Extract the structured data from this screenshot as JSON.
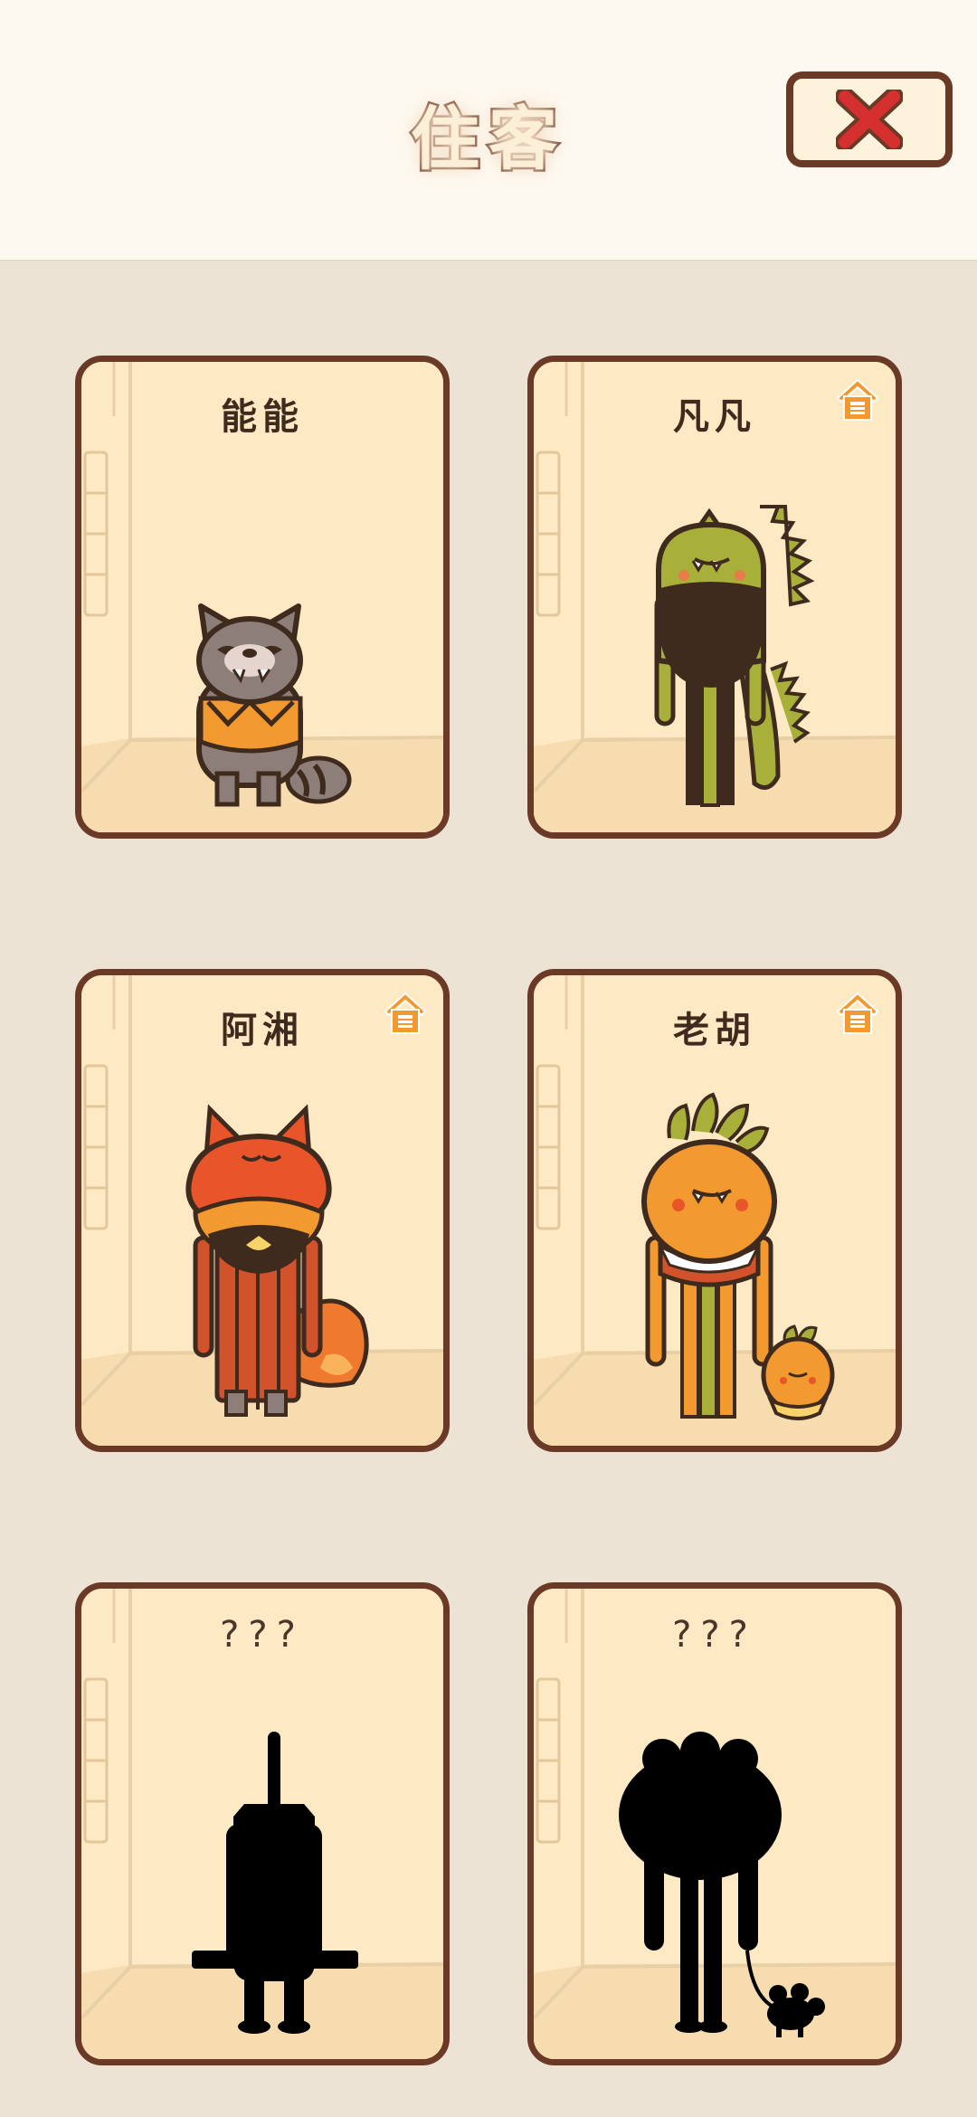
{
  "header": {
    "title": "住客",
    "close_icon": "close-x-icon"
  },
  "colors": {
    "page_bg": "#ede3d4",
    "header_bg": "#fdf9f0",
    "card_bg": "#fde9c4",
    "card_border": "#6a3a26",
    "close_x": "#d62f2f",
    "badge": "#f2992f"
  },
  "residents": [
    {
      "name": "能能",
      "has_house": false,
      "unlocked": true,
      "character": "raccoon"
    },
    {
      "name": "凡凡",
      "has_house": true,
      "unlocked": true,
      "character": "green-dinosaur"
    },
    {
      "name": "阿湘",
      "has_house": true,
      "unlocked": true,
      "character": "red-fox"
    },
    {
      "name": "老胡",
      "has_house": true,
      "unlocked": true,
      "character": "orange-pineapple"
    },
    {
      "name": "???",
      "has_house": false,
      "unlocked": false,
      "character": "silhouette"
    },
    {
      "name": "???",
      "has_house": false,
      "unlocked": false,
      "character": "silhouette"
    }
  ]
}
